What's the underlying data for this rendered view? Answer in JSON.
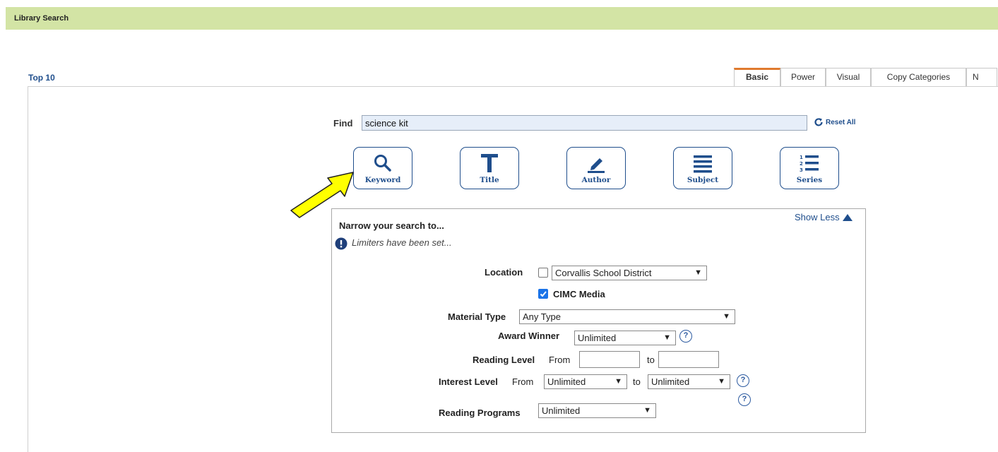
{
  "header": {
    "title": "Library Search"
  },
  "top10_link": "Top 10",
  "tabs": [
    "Basic",
    "Power",
    "Visual",
    "Copy Categories",
    "N"
  ],
  "find": {
    "label": "Find",
    "value": "science kit",
    "reset_label": "Reset All"
  },
  "search_buttons": [
    "Keyword",
    "Title",
    "Author",
    "Subject",
    "Series"
  ],
  "narrow": {
    "title": "Narrow your search to...",
    "show_less": "Show Less",
    "limiters_note": "Limiters have been set...",
    "location_label": "Location",
    "location_value": "Corvallis School District",
    "cimc_label": "CIMC Media",
    "material_type_label": "Material Type",
    "material_type_value": "Any Type",
    "award_winner_label": "Award Winner",
    "award_winner_value": "Unlimited",
    "reading_level_label": "Reading Level",
    "from_label": "From",
    "to_label": "to",
    "interest_level_label": "Interest Level",
    "interest_from_value": "Unlimited",
    "interest_to_value": "Unlimited",
    "reading_programs_label": "Reading Programs",
    "reading_programs_value": "Unlimited"
  },
  "colors": {
    "header_bg": "#d3e4a5",
    "link_blue": "#1f4e8c",
    "active_tab": "#e07a2e",
    "arrow": "#ffff00"
  }
}
